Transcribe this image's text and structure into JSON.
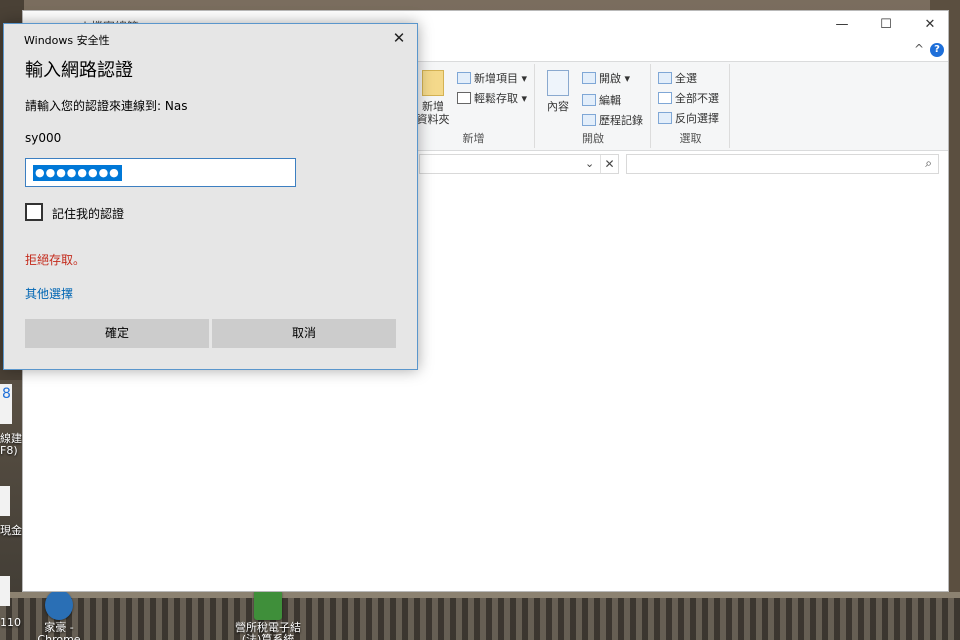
{
  "explorer": {
    "title": "| 檔案總管",
    "window_controls": {
      "minimize": "—",
      "maximize": "☐",
      "close": "✕"
    },
    "ribbon": {
      "help_label": "?",
      "collapse_label": "^",
      "new_group": {
        "label": "新增",
        "new_folder_label": "新增\n資料夾",
        "new_item_label": "新增項目 ▾",
        "easy_access_label": "輕鬆存取 ▾"
      },
      "open_group": {
        "label": "開啟",
        "properties_label": "內容",
        "open_label": "開啟 ▾",
        "edit_label": "編輯",
        "history_label": "歷程記錄"
      },
      "select_group": {
        "label": "選取",
        "select_all_label": "全選",
        "select_none_label": "全部不選",
        "invert_label": "反向選擇"
      }
    },
    "address": {
      "chevron": "⌄",
      "clear": "✕"
    },
    "search": {
      "icon": "⌕"
    }
  },
  "dialog": {
    "caption": "Windows 安全性",
    "close": "✕",
    "heading": "輸入網路認證",
    "prompt": "請輸入您的認證來連線到: Nas",
    "username": "sy000",
    "password_masked": "●●●●●●●●",
    "remember_label": "記住我的認證",
    "error_text": "拒絕存取。",
    "more_choices": "其他選擇",
    "ok_label": "確定",
    "cancel_label": "取消"
  },
  "desktop": {
    "icons": [
      {
        "label": "家豪 -\nChrome"
      },
      {
        "label": "營所稅電子結\n(法)算系統"
      }
    ],
    "left_strip": [
      "8",
      "線建",
      "F8)",
      "現金",
      "110"
    ]
  },
  "colors": {
    "dialog_bg": "#e6e6e6",
    "accent": "#0078d7",
    "error": "#c42b1c",
    "link": "#0066b4"
  }
}
